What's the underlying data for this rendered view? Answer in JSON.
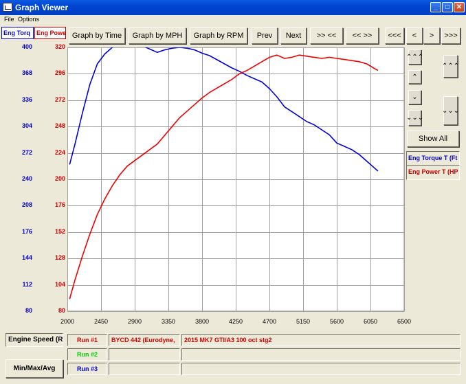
{
  "window": {
    "title": "Graph Viewer",
    "min": "_",
    "max": "□",
    "close": "✕"
  },
  "menu": [
    "File",
    "Options"
  ],
  "top_tabs": {
    "torque": "Eng Torq",
    "power": "Eng Powe"
  },
  "toolbar": {
    "by_time": "Graph by Time",
    "by_mph": "Graph by MPH",
    "by_rpm": "Graph by RPM",
    "prev": "Prev",
    "next": "Next",
    "zoom_in": ">> <<",
    "zoom_out": "<< >>",
    "first": "<<<",
    "back": "<",
    "fwd": ">",
    "last": ">>>"
  },
  "right_panel": {
    "up_fast": "⌃⌃⌃",
    "up": "⌃",
    "down": "⌄",
    "down_fast": "⌄⌄⌄",
    "show_all": "Show All",
    "legend_torque": "Eng Torque T (Ft",
    "legend_power": "Eng Power T (HP"
  },
  "bottom": {
    "axis_label": "Engine Speed (RF",
    "minmax": "Min/Max/Avg",
    "runs": [
      {
        "label": "Run #1",
        "color": "#cc0000",
        "car": "BYCD 442 (Eurodyne,",
        "desc": "2015 MK7 GTI/A3 100 oct stg2"
      },
      {
        "label": "Run #2",
        "color": "#00cc00",
        "car": "",
        "desc": ""
      },
      {
        "label": "Run #3",
        "color": "#0000cc",
        "car": "",
        "desc": ""
      }
    ]
  },
  "colors": {
    "torque": "#0000dd",
    "power": "#ee0000"
  },
  "chart_data": {
    "type": "line",
    "xlabel": "Engine Speed (RF",
    "x_ticks": [
      "2000",
      "2450",
      "2900",
      "3350",
      "3800",
      "4250",
      "4700",
      "5150",
      "5600",
      "6050",
      "6500"
    ],
    "y_ticks_torque": [
      "400",
      "368",
      "336",
      "304",
      "272",
      "240",
      "208",
      "176",
      "144",
      "112",
      "80"
    ],
    "y_ticks_power": [
      "320",
      "296",
      "272",
      "248",
      "224",
      "200",
      "176",
      "152",
      "128",
      "104",
      "80"
    ],
    "xlim": [
      2000,
      6500
    ],
    "ylim_torque": [
      80,
      400
    ],
    "ylim_power": [
      80,
      320
    ],
    "grid": true,
    "series": [
      {
        "name": "Eng Torque T (Ft",
        "axis": "torque",
        "x": [
          2030,
          2100,
          2200,
          2300,
          2400,
          2500,
          2600,
          2700,
          2800,
          2900,
          3000,
          3100,
          3200,
          3300,
          3400,
          3500,
          3600,
          3700,
          3800,
          3900,
          4000,
          4100,
          4200,
          4300,
          4400,
          4500,
          4600,
          4700,
          4800,
          4900,
          5000,
          5100,
          5200,
          5300,
          5400,
          5500,
          5600,
          5700,
          5800,
          5900,
          6000,
          6100,
          6150
        ],
        "y": [
          258,
          282,
          320,
          355,
          380,
          392,
          400,
          406,
          409,
          406,
          402,
          398,
          394,
          397,
          399,
          400,
          399,
          397,
          393,
          390,
          385,
          380,
          375,
          371,
          366,
          362,
          358,
          350,
          340,
          328,
          322,
          316,
          310,
          306,
          300,
          294,
          284,
          280,
          276,
          270,
          262,
          254,
          250
        ]
      },
      {
        "name": "Eng Power T (HP",
        "axis": "power",
        "x": [
          2030,
          2100,
          2200,
          2300,
          2400,
          2500,
          2600,
          2700,
          2800,
          2900,
          3000,
          3100,
          3200,
          3300,
          3400,
          3500,
          3600,
          3700,
          3800,
          3900,
          4000,
          4100,
          4200,
          4300,
          4400,
          4500,
          4600,
          4700,
          4800,
          4900,
          5000,
          5100,
          5200,
          5300,
          5400,
          5500,
          5600,
          5700,
          5800,
          5900,
          6000,
          6100,
          6150
        ],
        "y": [
          91,
          108,
          130,
          150,
          168,
          182,
          194,
          204,
          212,
          217,
          222,
          227,
          232,
          240,
          248,
          256,
          262,
          268,
          274,
          279,
          283,
          287,
          291,
          296,
          299,
          303,
          307,
          311,
          313,
          310,
          311,
          313,
          312,
          311,
          310,
          311,
          310,
          309,
          308,
          307,
          305,
          301,
          299
        ]
      }
    ]
  }
}
